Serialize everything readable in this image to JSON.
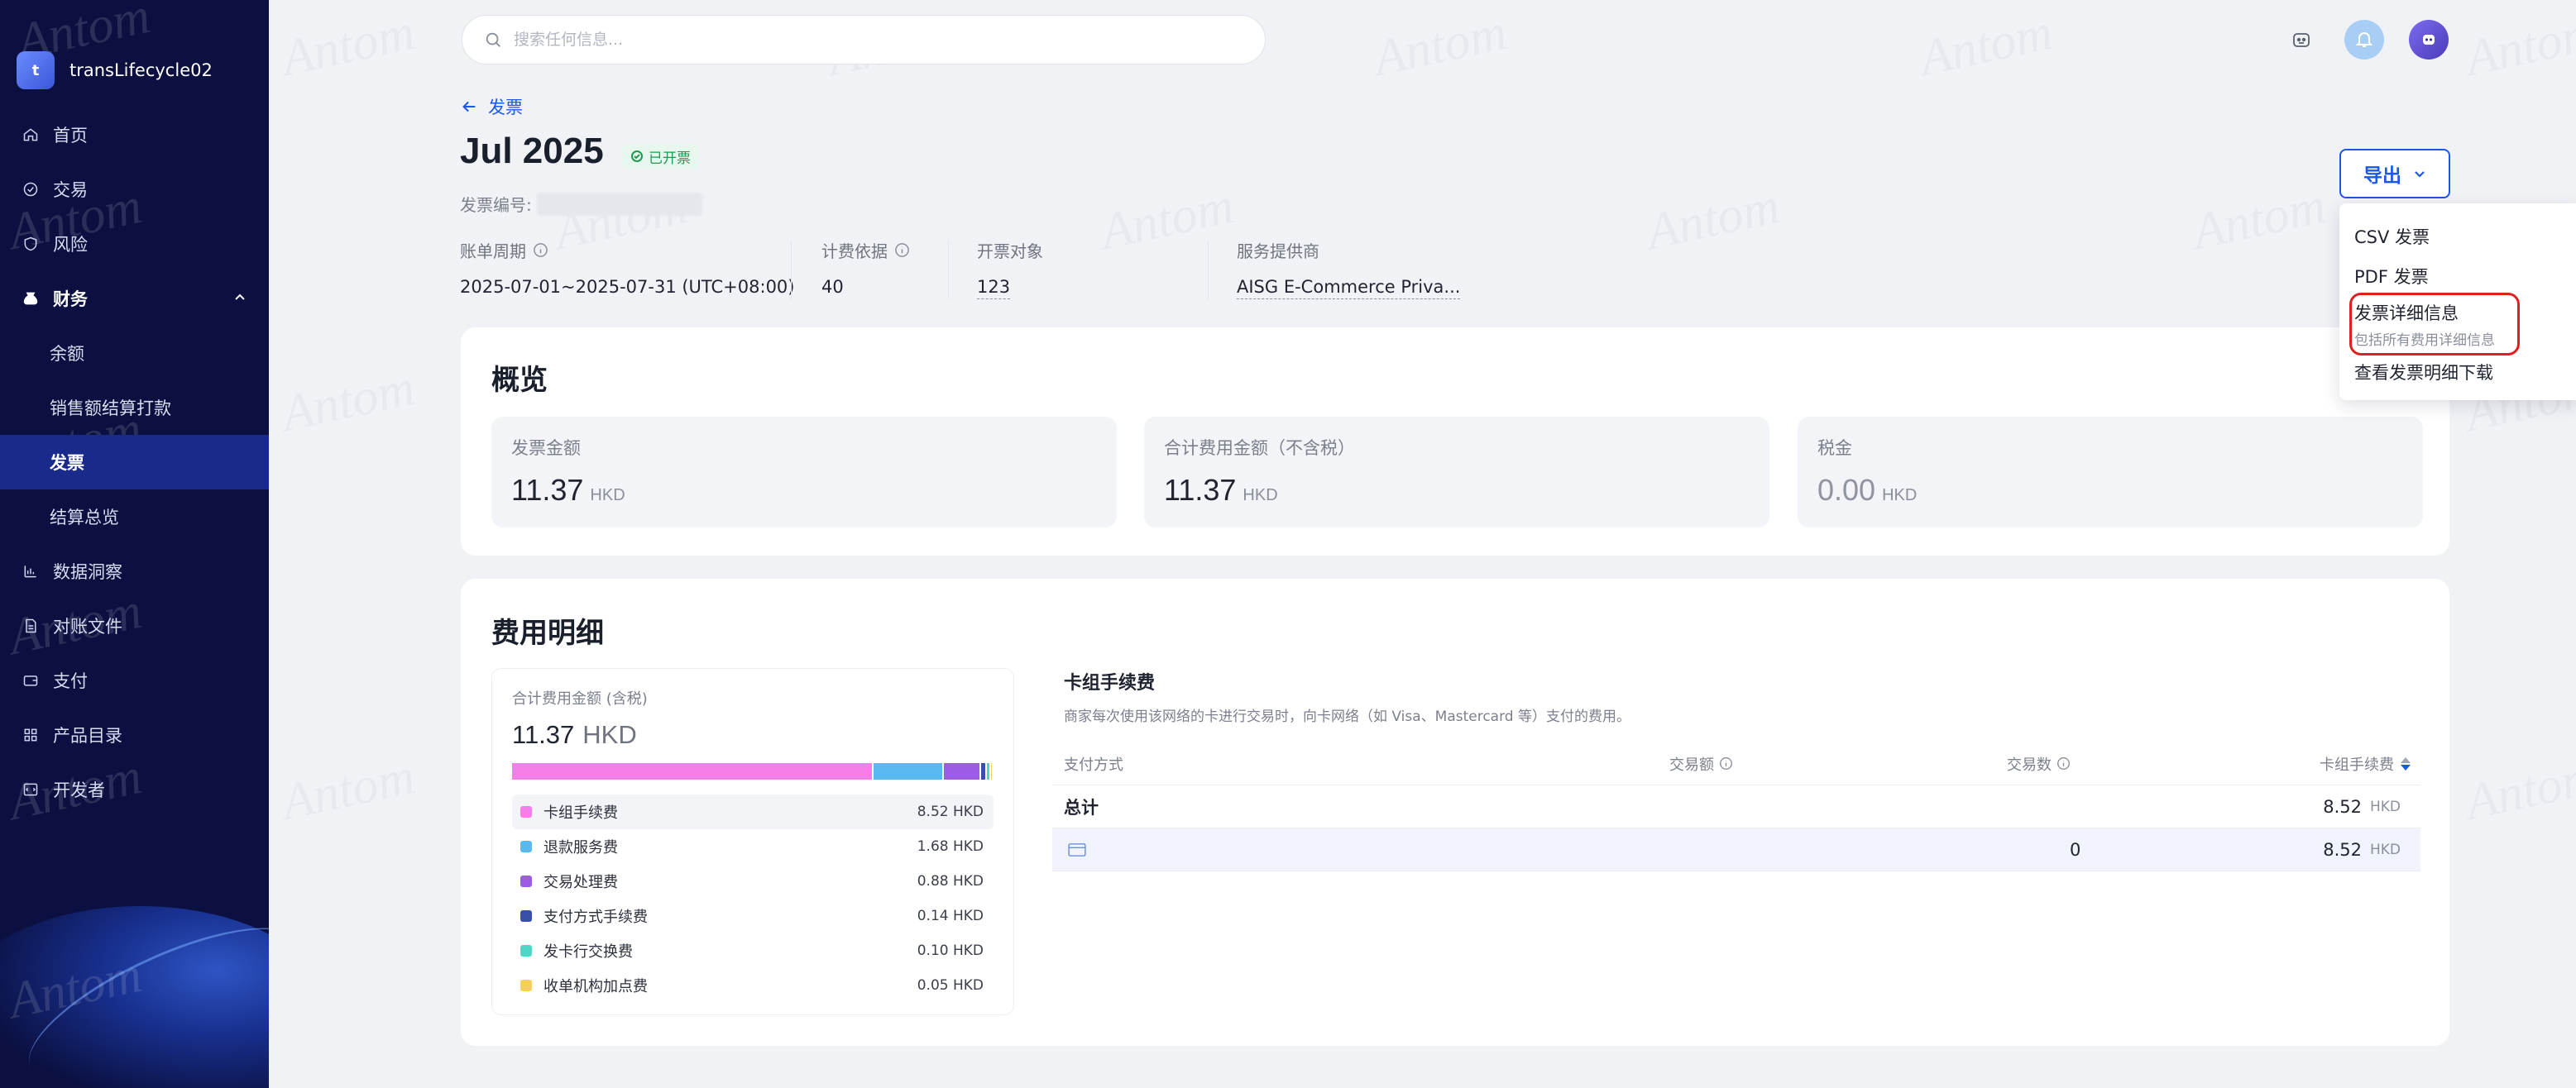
{
  "org": {
    "initial": "t",
    "name": "transLifecycle02"
  },
  "nav": [
    {
      "label": "首页",
      "icon": "home-icon"
    },
    {
      "label": "交易",
      "icon": "transaction-icon"
    },
    {
      "label": "风险",
      "icon": "shield-icon"
    },
    {
      "label": "财务",
      "icon": "finance-icon",
      "expanded": true
    },
    {
      "label": "余额",
      "sub": true
    },
    {
      "label": "销售额结算打款",
      "sub": true
    },
    {
      "label": "发票",
      "sub": true,
      "active": true
    },
    {
      "label": "结算总览",
      "sub": true
    },
    {
      "label": "数据洞察",
      "icon": "chart-icon"
    },
    {
      "label": "对账文件",
      "icon": "file-icon"
    },
    {
      "label": "支付",
      "icon": "wallet-icon"
    },
    {
      "label": "产品目录",
      "icon": "grid-icon"
    },
    {
      "label": "开发者",
      "icon": "code-icon"
    }
  ],
  "search": {
    "placeholder": "搜索任何信息..."
  },
  "header": {
    "back_label": "发票",
    "title": "Jul 2025",
    "status": "已开票",
    "invoice_no_label": "发票编号:"
  },
  "meta": {
    "billing_period": {
      "label": "账单周期",
      "value": "2025-07-01~2025-07-31 (UTC+08:00)"
    },
    "billing_basis": {
      "label": "计费依据",
      "value": "40"
    },
    "bill_to": {
      "label": "开票对象",
      "value": "123"
    },
    "provider": {
      "label": "服务提供商",
      "value": "AISG E-Commerce Priva..."
    }
  },
  "export": {
    "label": "导出",
    "options": {
      "csv": "CSV 发票",
      "pdf": "PDF 发票",
      "detail": "发票详细信息",
      "detail_sub": "包括所有费用详细信息",
      "downloads": "查看发票明细下载"
    }
  },
  "overview": {
    "title": "概览",
    "invoice_amount": {
      "label": "发票金额",
      "value": "11.37",
      "currency": "HKD"
    },
    "total_fees": {
      "label": "合计费用金额（不含税）",
      "value": "11.37",
      "currency": "HKD"
    },
    "tax": {
      "label": "税金",
      "value": "0.00",
      "currency": "HKD"
    }
  },
  "fees": {
    "title": "费用明细",
    "total_label": "合计费用金额 (含税)",
    "total_value": "11.37",
    "total_currency": "HKD",
    "items": [
      {
        "name": "卡组手续费",
        "amount": "8.52 HKD",
        "value": 8.52,
        "color": "#f57ee8"
      },
      {
        "name": "退款服务费",
        "amount": "1.68 HKD",
        "value": 1.68,
        "color": "#5ab9f0"
      },
      {
        "name": "交易处理费",
        "amount": "0.88 HKD",
        "value": 0.88,
        "color": "#9b5de5"
      },
      {
        "name": "支付方式手续费",
        "amount": "0.14 HKD",
        "value": 0.14,
        "color": "#3a4fa8"
      },
      {
        "name": "发卡行交换费",
        "amount": "0.10 HKD",
        "value": 0.1,
        "color": "#4fd6c7"
      },
      {
        "name": "收单机构加点费",
        "amount": "0.05 HKD",
        "value": 0.05,
        "color": "#f6cf5a"
      }
    ],
    "detail": {
      "title": "卡组手续费",
      "description": "商家每次使用该网络的卡进行交易时，向卡网络（如 Visa、Mastercard 等）支付的费用。",
      "columns": {
        "method": "支付方式",
        "amount": "交易额",
        "count": "交易数",
        "fee": "卡组手续费"
      },
      "total_row": {
        "label": "总计",
        "fee": "8.52",
        "currency": "HKD"
      },
      "rows": [
        {
          "count": "0",
          "fee": "8.52",
          "currency": "HKD"
        }
      ]
    }
  },
  "watermark": "Antom"
}
